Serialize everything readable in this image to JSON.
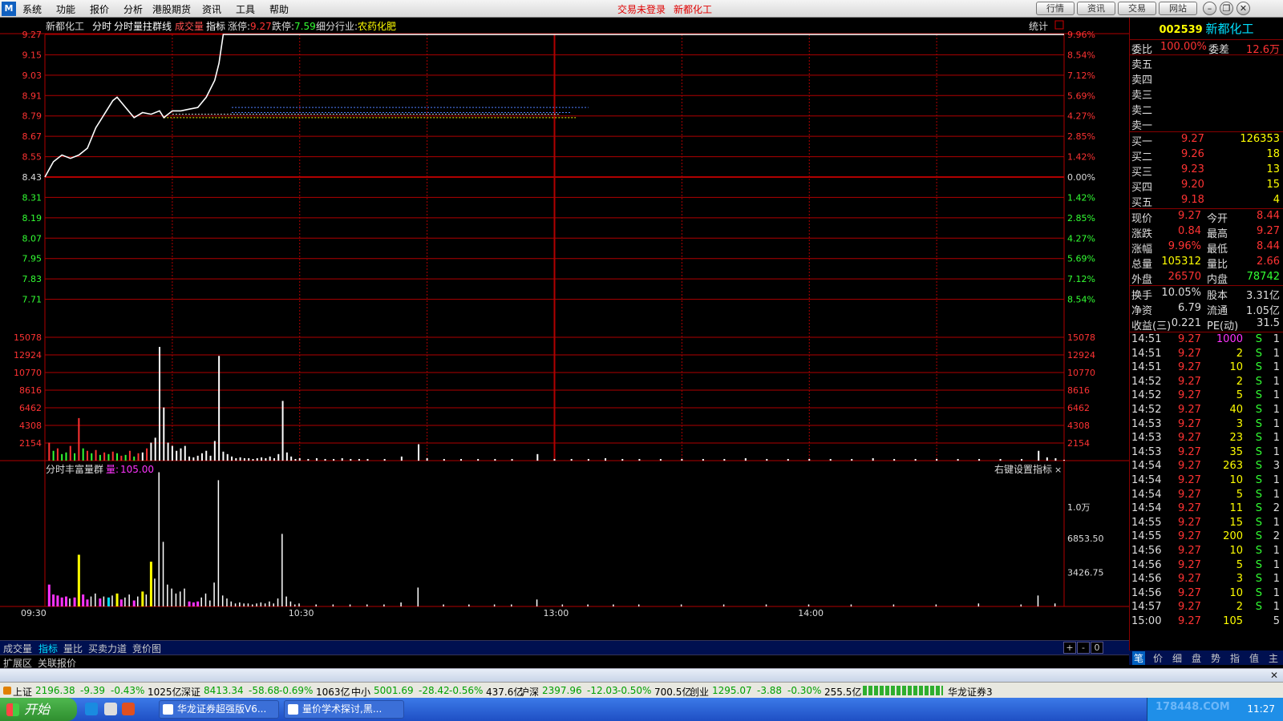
{
  "menubar": {
    "items": [
      "系统",
      "功能",
      "报价",
      "分析",
      "港股期货",
      "资讯",
      "工具",
      "帮助"
    ],
    "status_login": "交易未登录",
    "status_stock": "新都化工",
    "nav_buttons": [
      "行情",
      "资讯",
      "交易",
      "网站"
    ],
    "logo": "M"
  },
  "chart_header": {
    "stock": "新都化工",
    "mode1": "分时",
    "mode2": "分时量拄群线",
    "vol_label": "成交量",
    "indicator": "指标",
    "limit_up_label": "涨停:",
    "limit_up": "9.27",
    "limit_down_label": "跌停:",
    "limit_down": "7.59",
    "industry_label": "细分行业:",
    "industry": "农药化肥",
    "stats": "统计"
  },
  "indicator_header": {
    "name": "分时丰富量群",
    "vol_label": "量:",
    "vol_value": "105.00",
    "settings": "右键设置指标"
  },
  "chart_data": {
    "type": "line",
    "prev_close": 8.43,
    "price_ylim": [
      7.59,
      9.27
    ],
    "price_ticks": [
      "9.27",
      "9.15",
      "9.03",
      "8.91",
      "8.79",
      "8.67",
      "8.55",
      "8.43",
      "8.31",
      "8.19",
      "8.07",
      "7.95",
      "7.83",
      "7.71"
    ],
    "pct_ticks": [
      "9.96%",
      "8.54%",
      "7.12%",
      "5.69%",
      "4.27%",
      "2.85%",
      "1.42%",
      "0.00%",
      "1.42%",
      "2.85%",
      "4.27%",
      "5.69%",
      "7.12%",
      "8.54%"
    ],
    "volume_ticks": [
      "15078",
      "12924",
      "10770",
      "8616",
      "6462",
      "4308",
      "2154"
    ],
    "indicator_ticks": [
      "1.0万",
      "6853.50",
      "3426.75"
    ],
    "time_labels": [
      "09:30",
      "10:30",
      "13:00",
      "14:00"
    ],
    "price_path": [
      [
        0,
        8.43
      ],
      [
        2,
        8.52
      ],
      [
        4,
        8.56
      ],
      [
        6,
        8.54
      ],
      [
        8,
        8.56
      ],
      [
        10,
        8.6
      ],
      [
        12,
        8.72
      ],
      [
        14,
        8.8
      ],
      [
        16,
        8.88
      ],
      [
        17,
        8.9
      ],
      [
        19,
        8.84
      ],
      [
        21,
        8.78
      ],
      [
        23,
        8.81
      ],
      [
        25,
        8.8
      ],
      [
        27,
        8.82
      ],
      [
        28,
        8.78
      ],
      [
        30,
        8.82
      ],
      [
        32,
        8.82
      ],
      [
        34,
        8.83
      ],
      [
        36,
        8.84
      ],
      [
        38,
        8.9
      ],
      [
        40,
        9.0
      ],
      [
        41,
        9.1
      ],
      [
        42,
        9.27
      ],
      [
        240,
        9.27
      ]
    ],
    "avg_path": [
      [
        28,
        8.78
      ],
      [
        240,
        8.78
      ]
    ],
    "ref_lines": [
      {
        "price": 8.84,
        "from": 44,
        "to": 128,
        "color": "#5080ff"
      },
      {
        "price": 8.81,
        "from": 44,
        "to": 124,
        "color": "#5080ff"
      },
      {
        "price": 8.8,
        "from": 30,
        "to": 121,
        "color": "#e0e0e0"
      },
      {
        "price": 8.78,
        "from": 28,
        "to": 125,
        "color": "#ffff00"
      }
    ],
    "vol_ylim": [
      0,
      17232
    ],
    "volume_bars": [
      [
        1,
        2200,
        "r"
      ],
      [
        2,
        1200,
        "g"
      ],
      [
        3,
        1500,
        "r"
      ],
      [
        4,
        800,
        "g"
      ],
      [
        5,
        1000,
        "g"
      ],
      [
        6,
        1800,
        "r"
      ],
      [
        7,
        900,
        "g"
      ],
      [
        8,
        5200,
        "r"
      ],
      [
        9,
        1500,
        "g"
      ],
      [
        10,
        1200,
        "r"
      ],
      [
        11,
        900,
        "g"
      ],
      [
        12,
        1300,
        "r"
      ],
      [
        13,
        700,
        "g"
      ],
      [
        14,
        1000,
        "r"
      ],
      [
        15,
        800,
        "g"
      ],
      [
        16,
        1100,
        "r"
      ],
      [
        17,
        900,
        "g"
      ],
      [
        18,
        600,
        "r"
      ],
      [
        19,
        700,
        "g"
      ],
      [
        20,
        1200,
        "r"
      ],
      [
        21,
        500,
        "g"
      ],
      [
        22,
        900,
        "r"
      ],
      [
        23,
        1000,
        "w"
      ],
      [
        24,
        1500,
        "r"
      ],
      [
        25,
        2200,
        "w"
      ],
      [
        26,
        2800,
        "w"
      ],
      [
        27,
        13900,
        "w"
      ],
      [
        28,
        6500,
        "w"
      ],
      [
        29,
        2200,
        "w"
      ],
      [
        30,
        1800,
        "w"
      ],
      [
        31,
        1200,
        "w"
      ],
      [
        32,
        1500,
        "w"
      ],
      [
        33,
        1800,
        "w"
      ],
      [
        34,
        500,
        "w"
      ],
      [
        35,
        400,
        "w"
      ],
      [
        36,
        600,
        "w"
      ],
      [
        37,
        900,
        "w"
      ],
      [
        38,
        1200,
        "w"
      ],
      [
        39,
        600,
        "w"
      ],
      [
        40,
        2400,
        "w"
      ],
      [
        41,
        12800,
        "w"
      ],
      [
        42,
        1100,
        "w"
      ],
      [
        43,
        800,
        "w"
      ],
      [
        44,
        500,
        "w"
      ],
      [
        45,
        300,
        "w"
      ],
      [
        46,
        400,
        "w"
      ],
      [
        47,
        300,
        "w"
      ],
      [
        48,
        300,
        "w"
      ],
      [
        49,
        200,
        "w"
      ],
      [
        50,
        300,
        "w"
      ],
      [
        51,
        400,
        "w"
      ],
      [
        52,
        300,
        "w"
      ],
      [
        53,
        500,
        "w"
      ],
      [
        54,
        300,
        "w"
      ],
      [
        55,
        800,
        "w"
      ],
      [
        56,
        7300,
        "w"
      ],
      [
        57,
        1000,
        "w"
      ],
      [
        58,
        500,
        "w"
      ],
      [
        59,
        200,
        "w"
      ],
      [
        60,
        300,
        "w"
      ],
      [
        62,
        200,
        "w"
      ],
      [
        64,
        300,
        "w"
      ],
      [
        66,
        200,
        "w"
      ],
      [
        68,
        200,
        "w"
      ],
      [
        70,
        300,
        "w"
      ],
      [
        72,
        200,
        "w"
      ],
      [
        74,
        200,
        "w"
      ],
      [
        76,
        200,
        "w"
      ],
      [
        80,
        200,
        "w"
      ],
      [
        84,
        500,
        "w"
      ],
      [
        88,
        2000,
        "w"
      ],
      [
        90,
        300,
        "w"
      ],
      [
        94,
        200,
        "w"
      ],
      [
        98,
        200,
        "w"
      ],
      [
        102,
        200,
        "w"
      ],
      [
        106,
        200,
        "w"
      ],
      [
        110,
        200,
        "w"
      ],
      [
        116,
        800,
        "w"
      ],
      [
        120,
        200,
        "w"
      ],
      [
        124,
        200,
        "w"
      ],
      [
        128,
        200,
        "w"
      ],
      [
        132,
        300,
        "w"
      ],
      [
        136,
        200,
        "w"
      ],
      [
        140,
        200,
        "w"
      ],
      [
        145,
        200,
        "w"
      ],
      [
        150,
        200,
        "w"
      ],
      [
        155,
        200,
        "w"
      ],
      [
        160,
        200,
        "w"
      ],
      [
        165,
        300,
        "w"
      ],
      [
        170,
        200,
        "w"
      ],
      [
        175,
        200,
        "w"
      ],
      [
        180,
        200,
        "w"
      ],
      [
        185,
        200,
        "w"
      ],
      [
        190,
        200,
        "w"
      ],
      [
        195,
        300,
        "w"
      ],
      [
        200,
        200,
        "w"
      ],
      [
        205,
        200,
        "w"
      ],
      [
        210,
        200,
        "w"
      ],
      [
        215,
        200,
        "w"
      ],
      [
        220,
        200,
        "w"
      ],
      [
        225,
        200,
        "w"
      ],
      [
        230,
        200,
        "w"
      ],
      [
        234,
        1200,
        "w"
      ],
      [
        236,
        400,
        "w"
      ],
      [
        238,
        300,
        "w"
      ],
      [
        240,
        100,
        "w"
      ]
    ],
    "ind_ylim": [
      0,
      13700
    ],
    "ind_bars": [
      [
        1,
        2200,
        "m"
      ],
      [
        2,
        1200,
        "m"
      ],
      [
        3,
        1100,
        "m"
      ],
      [
        4,
        900,
        "m"
      ],
      [
        5,
        1000,
        "m"
      ],
      [
        6,
        800,
        "w"
      ],
      [
        7,
        900,
        "m"
      ],
      [
        8,
        5200,
        "y"
      ],
      [
        9,
        1200,
        "m"
      ],
      [
        10,
        700,
        "m"
      ],
      [
        11,
        1000,
        "w"
      ],
      [
        12,
        1300,
        "w"
      ],
      [
        13,
        800,
        "m"
      ],
      [
        14,
        1000,
        "w"
      ],
      [
        15,
        900,
        "c"
      ],
      [
        16,
        1100,
        "w"
      ],
      [
        17,
        1300,
        "y"
      ],
      [
        18,
        700,
        "m"
      ],
      [
        19,
        900,
        "w"
      ],
      [
        20,
        1200,
        "w"
      ],
      [
        21,
        600,
        "m"
      ],
      [
        22,
        1000,
        "w"
      ],
      [
        23,
        1500,
        "y"
      ],
      [
        24,
        1200,
        "w"
      ],
      [
        25,
        4500,
        "y"
      ],
      [
        26,
        2800,
        "w"
      ],
      [
        27,
        13500,
        "w"
      ],
      [
        28,
        6500,
        "w"
      ],
      [
        29,
        2200,
        "w"
      ],
      [
        30,
        1800,
        "w"
      ],
      [
        31,
        1300,
        "w"
      ],
      [
        32,
        1500,
        "w"
      ],
      [
        33,
        1800,
        "w"
      ],
      [
        34,
        500,
        "m"
      ],
      [
        35,
        400,
        "m"
      ],
      [
        36,
        500,
        "m"
      ],
      [
        37,
        900,
        "w"
      ],
      [
        38,
        1300,
        "w"
      ],
      [
        39,
        600,
        "w"
      ],
      [
        40,
        2400,
        "w"
      ],
      [
        41,
        12700,
        "w"
      ],
      [
        42,
        1100,
        "w"
      ],
      [
        43,
        800,
        "w"
      ],
      [
        44,
        500,
        "w"
      ],
      [
        45,
        300,
        "w"
      ],
      [
        46,
        400,
        "w"
      ],
      [
        47,
        300,
        "w"
      ],
      [
        48,
        300,
        "w"
      ],
      [
        49,
        200,
        "w"
      ],
      [
        50,
        300,
        "w"
      ],
      [
        51,
        400,
        "w"
      ],
      [
        52,
        300,
        "w"
      ],
      [
        53,
        500,
        "w"
      ],
      [
        54,
        300,
        "w"
      ],
      [
        55,
        800,
        "w"
      ],
      [
        56,
        7300,
        "w"
      ],
      [
        57,
        1000,
        "w"
      ],
      [
        58,
        500,
        "w"
      ],
      [
        59,
        200,
        "w"
      ],
      [
        60,
        300,
        "w"
      ],
      [
        64,
        200,
        "w"
      ],
      [
        68,
        200,
        "w"
      ],
      [
        72,
        200,
        "w"
      ],
      [
        76,
        200,
        "w"
      ],
      [
        80,
        200,
        "w"
      ],
      [
        84,
        400,
        "w"
      ],
      [
        88,
        1900,
        "w"
      ],
      [
        94,
        200,
        "w"
      ],
      [
        100,
        200,
        "w"
      ],
      [
        106,
        200,
        "w"
      ],
      [
        110,
        200,
        "w"
      ],
      [
        116,
        700,
        "w"
      ],
      [
        122,
        200,
        "w"
      ],
      [
        128,
        200,
        "w"
      ],
      [
        134,
        200,
        "w"
      ],
      [
        140,
        200,
        "w"
      ],
      [
        150,
        200,
        "w"
      ],
      [
        160,
        200,
        "w"
      ],
      [
        170,
        200,
        "w"
      ],
      [
        180,
        200,
        "w"
      ],
      [
        190,
        200,
        "w"
      ],
      [
        200,
        200,
        "w"
      ],
      [
        210,
        200,
        "w"
      ],
      [
        220,
        300,
        "w"
      ],
      [
        230,
        200,
        "w"
      ],
      [
        234,
        1100,
        "w"
      ],
      [
        238,
        300,
        "w"
      ]
    ]
  },
  "quote": {
    "code": "002539",
    "name": "新都化工",
    "wei_bi_label": "委比",
    "wei_bi": "100.00%",
    "wei_cha_label": "委差",
    "wei_cha": "12.6万",
    "sells": [
      {
        "label": "卖五"
      },
      {
        "label": "卖四"
      },
      {
        "label": "卖三"
      },
      {
        "label": "卖二"
      },
      {
        "label": "卖一"
      }
    ],
    "buys": [
      {
        "label": "买一",
        "price": "9.27",
        "vol": "126353"
      },
      {
        "label": "买二",
        "price": "9.26",
        "vol": "18"
      },
      {
        "label": "买三",
        "price": "9.23",
        "vol": "13"
      },
      {
        "label": "买四",
        "price": "9.20",
        "vol": "15"
      },
      {
        "label": "买五",
        "price": "9.18",
        "vol": "4"
      }
    ],
    "stats": [
      {
        "l1": "现价",
        "v1": "9.27",
        "c1": "r",
        "l2": "今开",
        "v2": "8.44",
        "c2": "r"
      },
      {
        "l1": "涨跌",
        "v1": "0.84",
        "c1": "r",
        "l2": "最高",
        "v2": "9.27",
        "c2": "r"
      },
      {
        "l1": "涨幅",
        "v1": "9.96%",
        "c1": "r",
        "l2": "最低",
        "v2": "8.44",
        "c2": "r"
      },
      {
        "l1": "总量",
        "v1": "105312",
        "c1": "y",
        "l2": "量比",
        "v2": "2.66",
        "c2": "r"
      },
      {
        "l1": "外盘",
        "v1": "26570",
        "c1": "r",
        "l2": "内盘",
        "v2": "78742",
        "c2": "g"
      }
    ],
    "stats2": [
      {
        "l1": "换手",
        "v1": "10.05%",
        "l2": "股本",
        "v2": "3.31亿"
      },
      {
        "l1": "净资",
        "v1": "6.79",
        "l2": "流通",
        "v2": "1.05亿"
      },
      {
        "l1": "收益(三)",
        "v1": "0.221",
        "l2": "PE(动)",
        "v2": "31.5"
      }
    ],
    "ticks": [
      {
        "t": "14:51",
        "p": "9.27",
        "v": "1000",
        "s": "S",
        "n": "1",
        "hv": true
      },
      {
        "t": "14:51",
        "p": "9.27",
        "v": "2",
        "s": "S",
        "n": "1"
      },
      {
        "t": "14:51",
        "p": "9.27",
        "v": "10",
        "s": "S",
        "n": "1"
      },
      {
        "t": "14:52",
        "p": "9.27",
        "v": "2",
        "s": "S",
        "n": "1"
      },
      {
        "t": "14:52",
        "p": "9.27",
        "v": "5",
        "s": "S",
        "n": "1"
      },
      {
        "t": "14:52",
        "p": "9.27",
        "v": "40",
        "s": "S",
        "n": "1"
      },
      {
        "t": "14:53",
        "p": "9.27",
        "v": "3",
        "s": "S",
        "n": "1"
      },
      {
        "t": "14:53",
        "p": "9.27",
        "v": "23",
        "s": "S",
        "n": "1"
      },
      {
        "t": "14:53",
        "p": "9.27",
        "v": "35",
        "s": "S",
        "n": "1"
      },
      {
        "t": "14:54",
        "p": "9.27",
        "v": "263",
        "s": "S",
        "n": "3"
      },
      {
        "t": "14:54",
        "p": "9.27",
        "v": "10",
        "s": "S",
        "n": "1"
      },
      {
        "t": "14:54",
        "p": "9.27",
        "v": "5",
        "s": "S",
        "n": "1"
      },
      {
        "t": "14:54",
        "p": "9.27",
        "v": "11",
        "s": "S",
        "n": "2"
      },
      {
        "t": "14:55",
        "p": "9.27",
        "v": "15",
        "s": "S",
        "n": "1"
      },
      {
        "t": "14:55",
        "p": "9.27",
        "v": "200",
        "s": "S",
        "n": "2"
      },
      {
        "t": "14:56",
        "p": "9.27",
        "v": "10",
        "s": "S",
        "n": "1"
      },
      {
        "t": "14:56",
        "p": "9.27",
        "v": "5",
        "s": "S",
        "n": "1"
      },
      {
        "t": "14:56",
        "p": "9.27",
        "v": "3",
        "s": "S",
        "n": "1"
      },
      {
        "t": "14:56",
        "p": "9.27",
        "v": "10",
        "s": "S",
        "n": "1"
      },
      {
        "t": "14:57",
        "p": "9.27",
        "v": "2",
        "s": "S",
        "n": "1"
      },
      {
        "t": "15:00",
        "p": "9.27",
        "v": "105",
        "s": "",
        "n": "5"
      }
    ]
  },
  "tabs": {
    "bottom": [
      "成交量",
      "指标",
      "量比",
      "买卖力道",
      "竞价图"
    ],
    "active_bottom": "指标",
    "bottom2": [
      "扩展区",
      "关联报价"
    ],
    "right": [
      "笔",
      "价",
      "细",
      "盘",
      "势",
      "指",
      "值",
      "主"
    ],
    "active_right": "笔",
    "buttons": [
      "+",
      "-",
      "0"
    ]
  },
  "ticker": [
    {
      "name": "上证",
      "val": "2196.38",
      "chg": "-9.39",
      "pct": "-0.43%",
      "amt": "1025亿"
    },
    {
      "name": "深证",
      "val": "8413.34",
      "chg": "-58.68",
      "pct": "-0.69%",
      "amt": "1063亿"
    },
    {
      "name": "中小",
      "val": "5001.69",
      "chg": "-28.42",
      "pct": "-0.56%",
      "amt": "437.6亿"
    },
    {
      "name": "沪深",
      "val": "2397.96",
      "chg": "-12.03",
      "pct": "-0.50%",
      "amt": "700.5亿"
    },
    {
      "name": "创业",
      "val": "1295.07",
      "chg": "-3.88",
      "pct": "-0.30%",
      "amt": "255.5亿"
    }
  ],
  "ticker_broker": "华龙证券3",
  "taskbar": {
    "start": "开始",
    "tasks": [
      "华龙证券超强版V6...",
      "量价学术探讨,黑..."
    ],
    "clock": "11:27",
    "watermark": "178448.COM"
  },
  "colors": {
    "up": "#ff3333",
    "down": "#33ff33",
    "grid": "#b00000",
    "bg": "#000000",
    "accent_cyan": "#00e0ff",
    "yellow": "#ffff00"
  }
}
